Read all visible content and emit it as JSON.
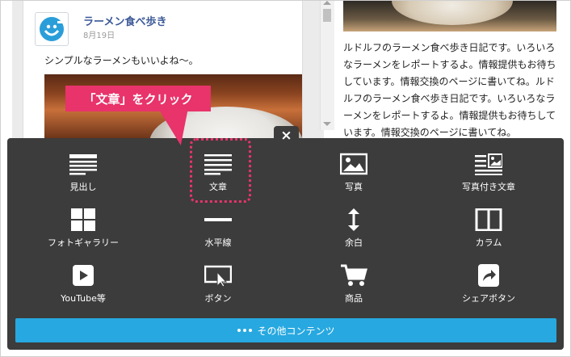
{
  "post": {
    "author": "ラーメン食べ歩き",
    "date": "8月19日",
    "text": "シンプルなラーメンもいいよね〜。"
  },
  "right_text": "ルドルフのラーメン食べ歩き日記です。いろいろなラーメンをレポートするよ。情報提供もお待ちしています。情報交換のページに書いてね。ルドルフのラーメン食べ歩き日記です。いろいろなラーメンをレポートするよ。情報提供もお待ちしています。情報交換のページに書いてね。",
  "callout": "「文章」をクリック",
  "panel": {
    "close": "×",
    "items": [
      {
        "label": "見出し",
        "icon": "heading-icon"
      },
      {
        "label": "文章",
        "icon": "text-icon"
      },
      {
        "label": "写真",
        "icon": "photo-icon"
      },
      {
        "label": "写真付き文章",
        "icon": "photo-text-icon"
      },
      {
        "label": "フォトギャラリー",
        "icon": "gallery-icon"
      },
      {
        "label": "水平線",
        "icon": "horizontal-line-icon"
      },
      {
        "label": "余白",
        "icon": "spacing-icon"
      },
      {
        "label": "カラム",
        "icon": "column-icon"
      },
      {
        "label": "YouTube等",
        "icon": "video-icon"
      },
      {
        "label": "ボタン",
        "icon": "button-icon"
      },
      {
        "label": "商品",
        "icon": "cart-icon"
      },
      {
        "label": "シェアボタン",
        "icon": "share-icon"
      }
    ],
    "more_label": "その他コンテンツ"
  },
  "colors": {
    "accent": "#e8336b",
    "panel": "#3c3c3c",
    "button": "#27a8e0",
    "link": "#3b5998"
  }
}
